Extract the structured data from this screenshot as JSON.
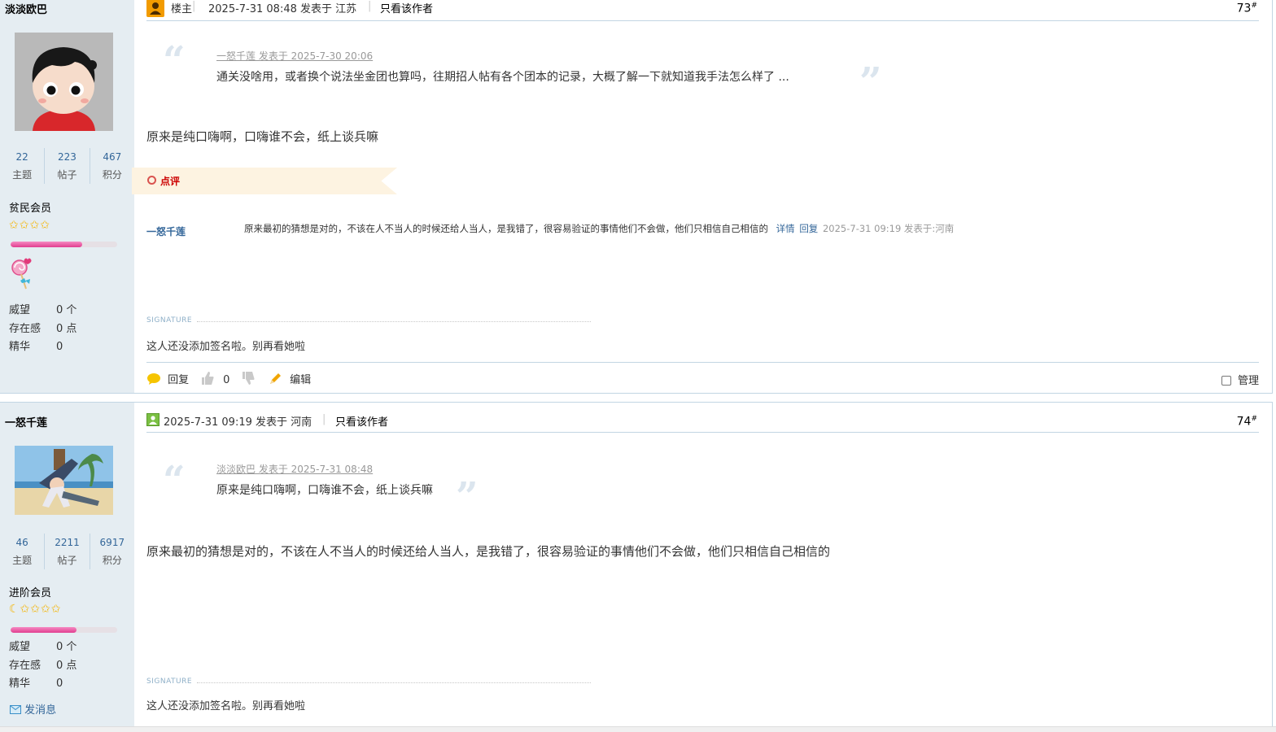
{
  "posts": [
    {
      "author": "淡淡欧巴",
      "stats": [
        {
          "num": "22",
          "label": "主题"
        },
        {
          "num": "223",
          "label": "帖子"
        },
        {
          "num": "467",
          "label": "积分"
        }
      ],
      "rank": "贫民会员",
      "stars": "✩✩✩✩",
      "progress": 0.67,
      "info": [
        {
          "k": "威望",
          "v": "0 个"
        },
        {
          "k": "存在感",
          "v": "0 点"
        },
        {
          "k": "精华",
          "v": "0"
        }
      ],
      "header": {
        "badge": "楼主",
        "time": "2025-7-31 08:48 发表于 江苏",
        "only_author": "只看该作者",
        "floor": "73",
        "floor_sup": "#"
      },
      "quote": {
        "source": "一怒千莲 发表于 2025-7-30 20:06",
        "text": "通关没啥用，或者换个说法坐金团也算吗，往期招人帖有各个团本的记录，大概了解一下就知道我手法怎么样了 ..."
      },
      "content": "原来是纯口嗨啊，口嗨谁不会，纸上谈兵嘛",
      "rating_label": "点评",
      "comment": {
        "user": "一怒千莲",
        "text": "原来最初的猜想是对的，不该在人不当人的时候还给人当人，是我错了，很容易验证的事情他们不会做，他们只相信自己相信的",
        "detail": "详情",
        "reply": "回复",
        "meta": "2025-7-31 09:19 发表于:河南"
      },
      "signature_label": "SIGNATURE",
      "signature": "这人还没添加签名啦。别再看她啦",
      "actions": {
        "reply": "回复",
        "likes": "0",
        "edit": "编辑",
        "manage": "管理"
      }
    },
    {
      "author": "一怒千莲",
      "stats": [
        {
          "num": "46",
          "label": "主题"
        },
        {
          "num": "2211",
          "label": "帖子"
        },
        {
          "num": "6917",
          "label": "积分"
        }
      ],
      "rank": "进阶会员",
      "stars": "☾✩✩✩✩",
      "progress": 0.62,
      "info": [
        {
          "k": "威望",
          "v": "0 个"
        },
        {
          "k": "存在感",
          "v": "0 点"
        },
        {
          "k": "精华",
          "v": "0"
        }
      ],
      "send_message": "发消息",
      "header": {
        "time": "2025-7-31 09:19 发表于 河南",
        "only_author": "只看该作者",
        "floor": "74",
        "floor_sup": "#"
      },
      "quote": {
        "source": "淡淡欧巴 发表于 2025-7-31 08:48",
        "text": "原来是纯口嗨啊，口嗨谁不会，纸上谈兵嘛"
      },
      "content": "原来最初的猜想是对的，不该在人不当人的时候还给人当人，是我错了，很容易验证的事情他们不会做，他们只相信自己相信的",
      "signature_label": "SIGNATURE",
      "signature": "这人还没添加签名啦。别再看她啦"
    }
  ]
}
